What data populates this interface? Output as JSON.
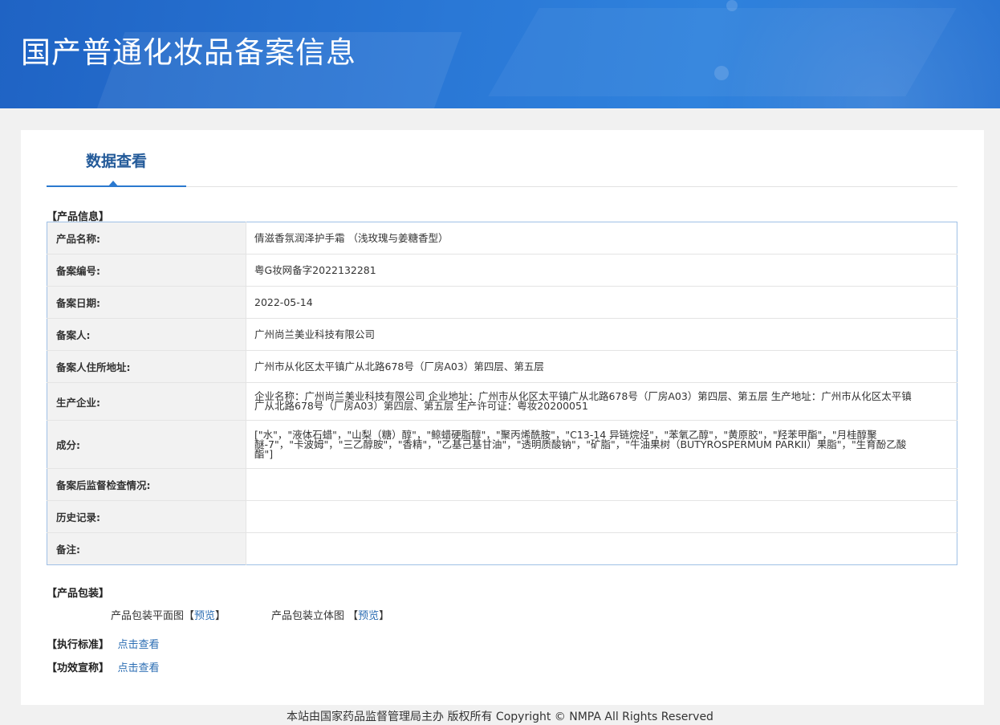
{
  "header": {
    "title": "国产普通化妆品备案信息"
  },
  "tabs": [
    {
      "label": "数据查看"
    }
  ],
  "product_info": {
    "section_label": "【产品信息】",
    "rows": [
      {
        "label": "产品名称:",
        "value": "倩滋香氛润泽护手霜 （浅玫瑰与姜糖香型）"
      },
      {
        "label": "备案编号:",
        "value": "粤G妆网备字2022132281"
      },
      {
        "label": "备案日期:",
        "value": "2022-05-14"
      },
      {
        "label": "备案人:",
        "value": "广州尚兰美业科技有限公司"
      },
      {
        "label": "备案人住所地址:",
        "value": "广州市从化区太平镇广从北路678号（厂房A03）第四层、第五层"
      },
      {
        "label": "生产企业:",
        "value": "企业名称：广州尚兰美业科技有限公司 企业地址：广州市从化区太平镇广从北路678号（厂房A03）第四层、第五层 生产地址：广州市从化区太平镇广从北路678号（厂房A03）第四层、第五层 生产许可证：粤妆20200051"
      },
      {
        "label": "成分:",
        "value": "[\"水\"，\"液体石蜡\"，\"山梨（糖）醇\"，\"鲸蜡硬脂醇\"，\"聚丙烯酰胺\"，\"C13-14 异链烷烃\"，\"苯氧乙醇\"，\"黄原胶\"，\"羟苯甲酯\"，\"月桂醇聚醚-7\"，\"卡波姆\"，\"三乙醇胺\"，\"香精\"，\"乙基己基甘油\"，\"透明质酸钠\"，\"矿脂\"，\"牛油果树（BUTYROSPERMUM PARKII）果脂\"，\"生育酚乙酸酯\"]"
      },
      {
        "label": "备案后监督检查情况:",
        "value": ""
      },
      {
        "label": "历史记录:",
        "value": ""
      },
      {
        "label": "备注:",
        "value": ""
      }
    ]
  },
  "packaging": {
    "section_label": "【产品包装】",
    "flat_label": "产品包装平面图",
    "flat_link": "预览",
    "stereo_label": "产品包装立体图",
    "stereo_link": "预览"
  },
  "standard": {
    "section_label": "【执行标准】",
    "link": "点击查看"
  },
  "efficacy": {
    "section_label": "【功效宣称】",
    "link": "点击查看"
  },
  "footer": {
    "text": "本站由国家药品监督管理局主办 版权所有 Copyright © NMPA All Rights Reserved"
  }
}
